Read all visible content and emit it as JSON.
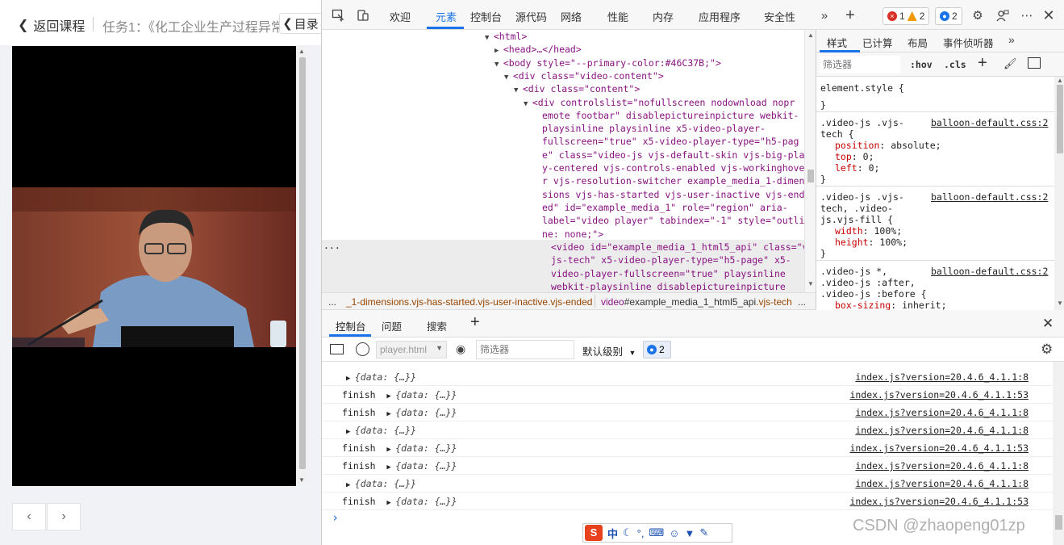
{
  "course": {
    "back_label": "返回课程",
    "task_title": "任务1：《化工企业生产过程异常",
    "toc_label": "目录"
  },
  "devtools": {
    "tabs": [
      {
        "label": "欢迎"
      },
      {
        "label": "元素"
      },
      {
        "label": "控制台"
      },
      {
        "label": "源代码"
      },
      {
        "label": "网络"
      },
      {
        "label": "性能"
      },
      {
        "label": "内存"
      },
      {
        "label": "应用程序"
      },
      {
        "label": "安全性"
      }
    ],
    "active_tab": "元素",
    "badges": {
      "errors": "1",
      "warnings": "2",
      "messages": "2"
    },
    "colors": {
      "accent": "#1a73e8",
      "error": "#d93025",
      "warning": "#f29900",
      "message": "#1a73e8"
    }
  },
  "elements": {
    "lines": [
      {
        "indent": 0,
        "tri": "▼",
        "text": "<html>"
      },
      {
        "indent": 1,
        "tri": "▶",
        "text": "<head>…</head>"
      },
      {
        "indent": 1,
        "tri": "▼",
        "text": "<body style=\"--primary-color:#46C37B;\">"
      },
      {
        "indent": 2,
        "tri": "▼",
        "text": "<div class=\"video-content\">"
      },
      {
        "indent": 3,
        "tri": "▼",
        "text": "<div class=\"content\">"
      },
      {
        "indent": 4,
        "tri": "▼",
        "text": "<div controlslist=\"nofullscreen nodownload nopr"
      },
      {
        "indent": 5,
        "tri": "",
        "text": "emote footbar\" disablepictureinpicture webkit-"
      },
      {
        "indent": 5,
        "tri": "",
        "text": "playsinline playsinline x5-video-player-"
      },
      {
        "indent": 5,
        "tri": "",
        "text": "fullscreen=\"true\" x5-video-player-type=\"h5-pag"
      },
      {
        "indent": 5,
        "tri": "",
        "text": "e\" class=\"video-js vjs-default-skin vjs-big-pla"
      },
      {
        "indent": 5,
        "tri": "",
        "text": "y-centered vjs-controls-enabled vjs-workinghove"
      },
      {
        "indent": 5,
        "tri": "",
        "text": "r vjs-resolution-switcher example_media_1-dimen"
      },
      {
        "indent": 5,
        "tri": "",
        "text": "sions vjs-has-started vjs-user-inactive vjs-end"
      },
      {
        "indent": 5,
        "tri": "",
        "text": "ed\" id=\"example_media_1\" role=\"region\" aria-"
      },
      {
        "indent": 5,
        "tri": "",
        "text": "label=\"video player\" tabindex=\"-1\" style=\"outli"
      },
      {
        "indent": 5,
        "tri": "",
        "text": "ne: none;\">"
      },
      {
        "indent": 6,
        "tri": "",
        "text": "<video id=\"example_media_1_html5_api\" class=\"v"
      },
      {
        "indent": 6,
        "tri": "",
        "text": "js-tech\" x5-video-player-type=\"h5-page\" x5-"
      },
      {
        "indent": 6,
        "tri": "",
        "text": "video-player-fullscreen=\"true\" playsinline"
      },
      {
        "indent": 6,
        "tri": "",
        "text": "webkit-playsinline disablepictureinpicture"
      }
    ],
    "dots": "...",
    "breadcrumb": {
      "more": "...",
      "item1": "_1-dimensions.vjs-has-started.vjs-user-inactive.vjs-ended",
      "item2_tag": "video",
      "item2_rest": "#example_media_1_html5_api",
      "item2_cls": ".vjs-tech",
      "more_right": "..."
    }
  },
  "styles": {
    "tabs": [
      "样式",
      "已计算",
      "布局",
      "事件侦听器"
    ],
    "filter_placeholder": "筛选器",
    "hov": ":hov",
    "cls": ".cls",
    "element_style": "element.style {",
    "close_brace": "}",
    "rules": [
      {
        "selector_lines": [
          ".video-js .vjs-",
          "tech {"
        ],
        "source": "balloon-default.css:2",
        "props": [
          [
            "position",
            "absolute"
          ],
          [
            "top",
            "0"
          ],
          [
            "left",
            "0"
          ]
        ]
      },
      {
        "selector_lines": [
          ".video-js .vjs-",
          "tech, .video-",
          "js.vjs-fill {"
        ],
        "source": "balloon-default.css:2",
        "props": [
          [
            "width",
            "100%"
          ],
          [
            "height",
            "100%"
          ]
        ]
      },
      {
        "selector_lines": [
          ".video-js *,",
          ".video-js :after,",
          ".video-js :before {"
        ],
        "source": "balloon-default.css:2",
        "props": [
          [
            "box-sizing",
            "inherit"
          ]
        ]
      }
    ]
  },
  "console": {
    "drawer_tabs": [
      "控制台",
      "问题",
      "搜索"
    ],
    "context": "player.html",
    "filter_placeholder": "筛选器",
    "level": "默认级别",
    "msg_count": "2",
    "rows": [
      {
        "label": "",
        "obj": "{data: {…}}",
        "source": "index.js?version=20.4.6_4.1.1:8"
      },
      {
        "label": "finish",
        "obj": "{data: {…}}",
        "source": "index.js?version=20.4.6_4.1.1:53"
      },
      {
        "label": "finish",
        "obj": "{data: {…}}",
        "source": "index.js?version=20.4.6_4.1.1:8"
      },
      {
        "label": "",
        "obj": "{data: {…}}",
        "source": "index.js?version=20.4.6_4.1.1:8"
      },
      {
        "label": "finish",
        "obj": "{data: {…}}",
        "source": "index.js?version=20.4.6_4.1.1:53"
      },
      {
        "label": "finish",
        "obj": "{data: {…}}",
        "source": "index.js?version=20.4.6_4.1.1:8"
      },
      {
        "label": "",
        "obj": "{data: {…}}",
        "source": "index.js?version=20.4.6_4.1.1:8"
      },
      {
        "label": "finish",
        "obj": "{data: {…}}",
        "source": "index.js?version=20.4.6_4.1.1:53"
      }
    ],
    "prompt": "›"
  },
  "ime": {
    "logo": "S",
    "mode": "中"
  },
  "watermark": "CSDN @zhaopeng01zp"
}
